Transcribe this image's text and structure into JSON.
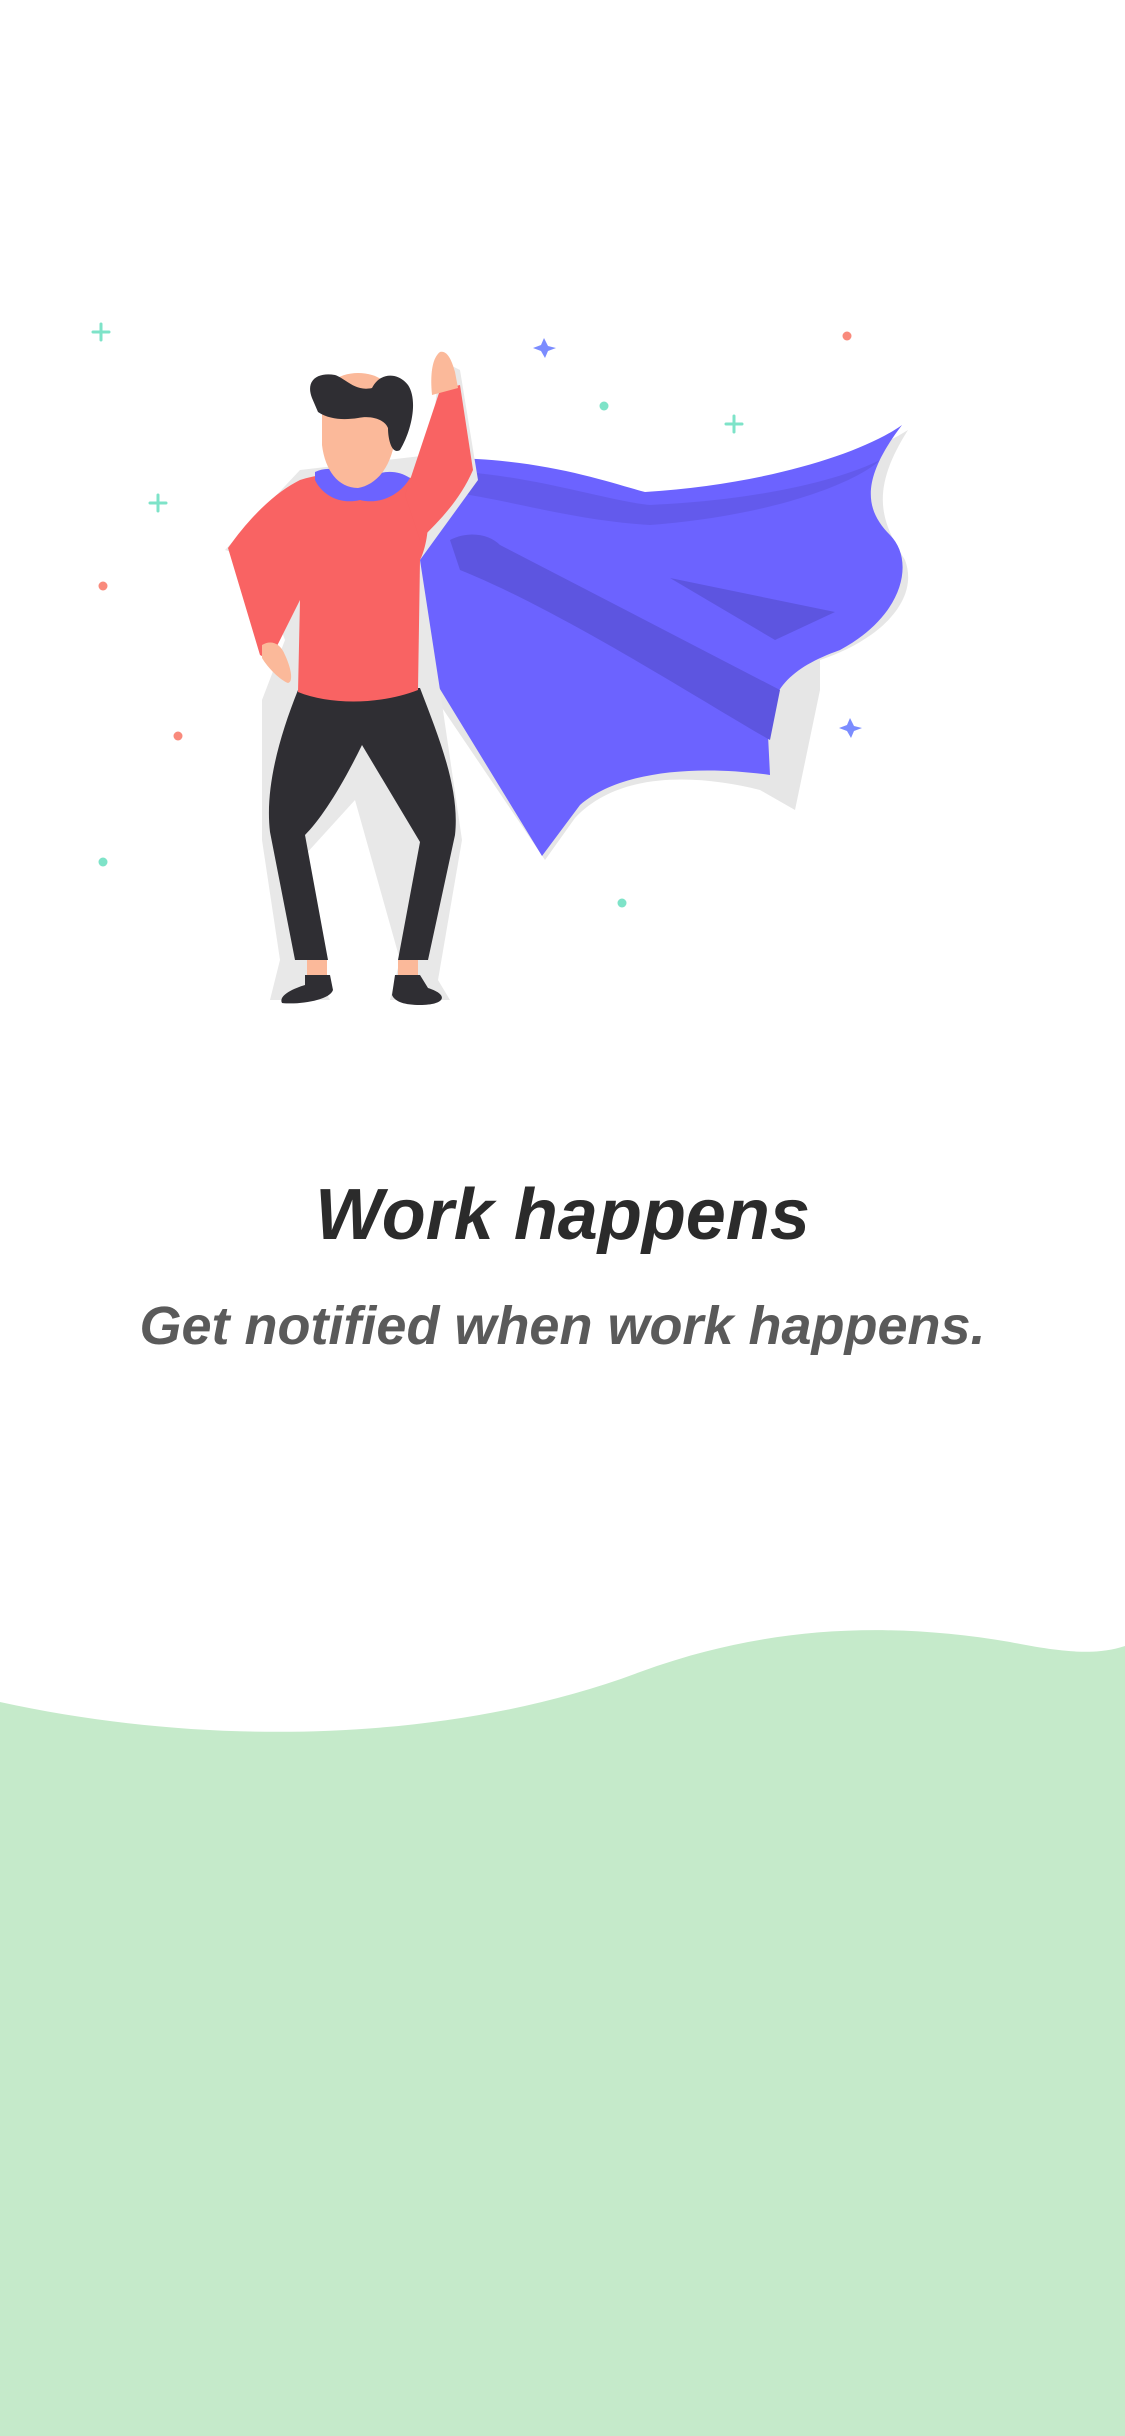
{
  "onboarding": {
    "illustration_name": "superhero-with-cape",
    "title": "Work happens",
    "subtitle": "Get notified when work happens."
  },
  "colors": {
    "background": "#ffffff",
    "wave": "#c5eaca",
    "cape": "#6c63ff",
    "cape_shadow": "#5d55e0",
    "shirt": "#f96363",
    "pants": "#2f2e33",
    "skin": "#fbb99a",
    "hair": "#2f2e33",
    "title_text": "#2b2b2b",
    "subtitle_text": "#5a5a5a"
  }
}
